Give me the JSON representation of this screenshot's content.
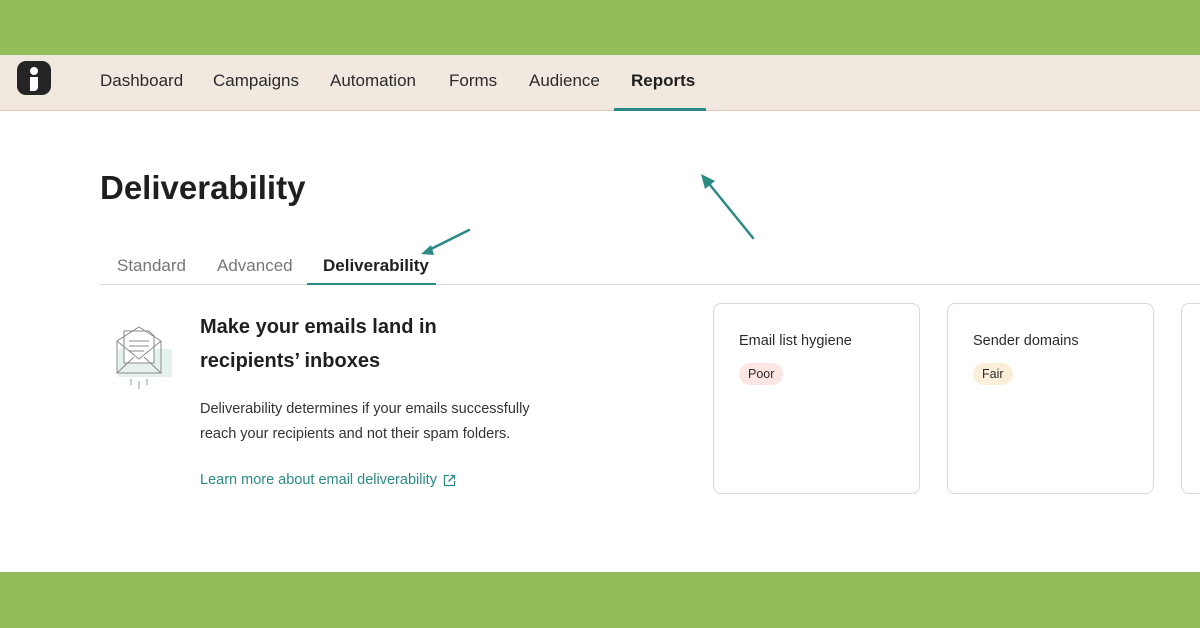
{
  "nav": {
    "items": [
      {
        "label": "Dashboard"
      },
      {
        "label": "Campaigns"
      },
      {
        "label": "Automation"
      },
      {
        "label": "Forms"
      },
      {
        "label": "Audience"
      },
      {
        "label": "Reports",
        "active": true
      }
    ]
  },
  "page": {
    "title": "Deliverability",
    "tabs": [
      {
        "label": "Standard"
      },
      {
        "label": "Advanced"
      },
      {
        "label": "Deliverability",
        "active": true
      }
    ]
  },
  "intro": {
    "headline": "Make your emails land in recipients’ inboxes",
    "description": "Deliverability determines if your emails successfully reach your recipients and not their spam folders.",
    "link_label": "Learn more about email deliverability"
  },
  "cards": [
    {
      "title": "Email list hygiene",
      "status": "Poor"
    },
    {
      "title": "Sender domains",
      "status": "Fair"
    }
  ],
  "colors": {
    "accent": "#2b8a84",
    "background_frame": "#93bd5a",
    "nav_background": "#f1e9df",
    "poor_badge": "#fbe6e3",
    "fair_badge": "#fcefd9"
  },
  "icons": [
    "app-logo-icon",
    "envelope-illustration-icon",
    "external-link-icon",
    "annotation-arrow-icon"
  ]
}
